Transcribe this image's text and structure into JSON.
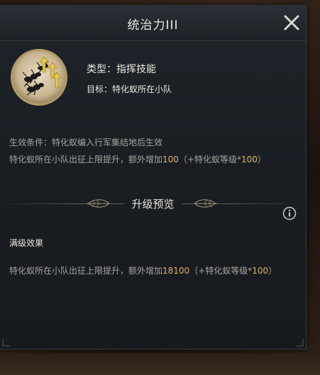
{
  "dialog": {
    "title": "统治力III",
    "close_icon": "close-icon"
  },
  "skill": {
    "icon": "ant-squad-skill-icon",
    "type_label": "类型：",
    "type_value": "指挥技能",
    "target_label": "目标：",
    "target_value": "特化蚁所在小队"
  },
  "condition": {
    "label": "生效条件：",
    "text": "特化蚁编入行军集结地后生效"
  },
  "effect": {
    "prefix": "特化蚁所在小队出征上限提升，额外增加",
    "value": "100",
    "paren_open": "（+特化蚁等级*",
    "multiplier": "100",
    "paren_close": "）"
  },
  "upgrade": {
    "title": "升级预览",
    "info_icon": "info-icon",
    "max_label": "满级效果",
    "max_prefix": "特化蚁所在小队出征上限提升，额外增加",
    "max_value": "18100",
    "max_paren_open": "（+特化蚁等级*",
    "max_multiplier": "100",
    "max_paren_close": "）"
  },
  "colors": {
    "accent_gold": "#e3b35f",
    "text_primary": "#e8e4da",
    "text_secondary": "#a6a59f",
    "panel_bg": "#1a1f24"
  }
}
